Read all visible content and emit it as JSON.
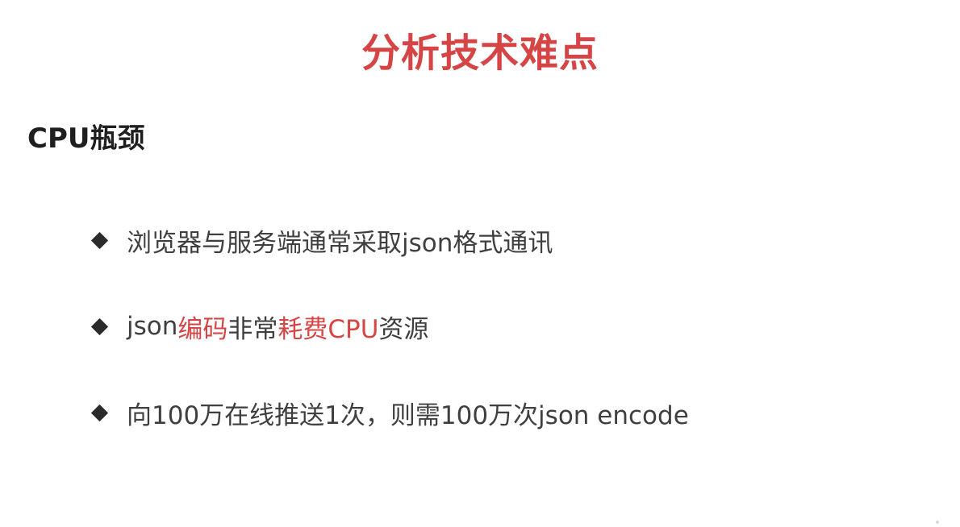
{
  "slide": {
    "title": "分析技术难点",
    "subtitle": "CPU瓶颈",
    "bullets": [
      {
        "text": "浏览器与服务端通常采取json格式通讯"
      },
      {
        "part1": "json",
        "part2": "编码",
        "part3": "非常",
        "part4": "耗费CPU",
        "part5": "资源"
      },
      {
        "text": "向100万在线推送1次，则需100万次json encode"
      }
    ]
  },
  "colors": {
    "accent": "#d64545",
    "heading": "#1f1f1f",
    "body": "#3f3f3f",
    "bullet": "#2b2b2b",
    "background": "#ffffff"
  },
  "icons": {
    "bullet_icon": "diamond-bullet-icon"
  }
}
